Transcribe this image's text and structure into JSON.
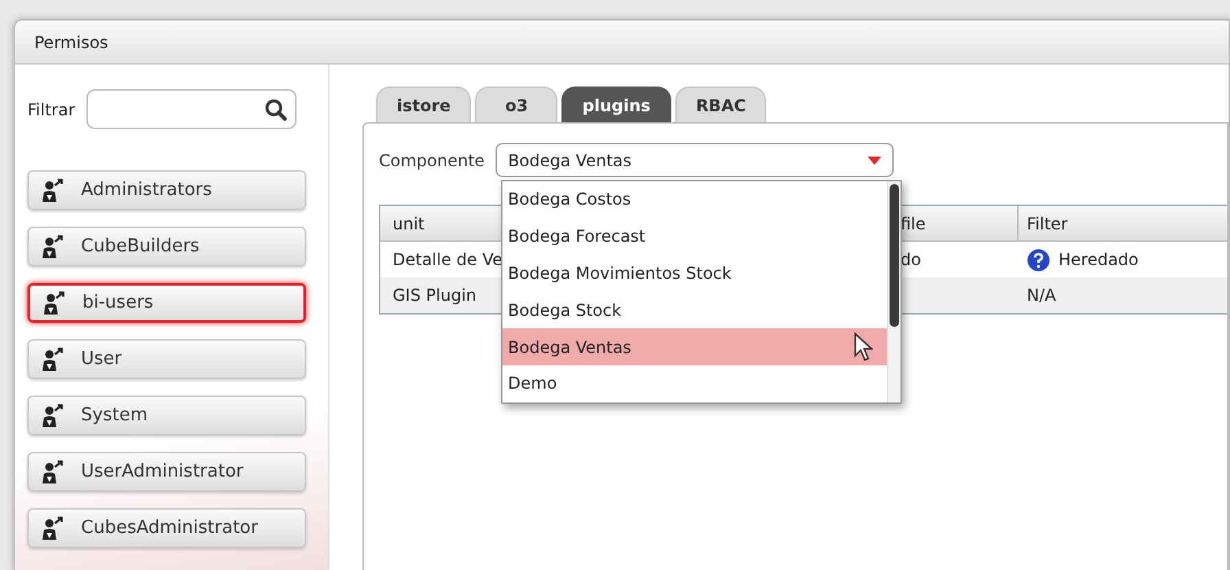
{
  "window": {
    "title": "Permisos"
  },
  "filter": {
    "label": "Filtrar"
  },
  "groups": [
    {
      "label": "Administrators",
      "selected": false
    },
    {
      "label": "CubeBuilders",
      "selected": false
    },
    {
      "label": "bi-users",
      "selected": true
    },
    {
      "label": "User",
      "selected": false
    },
    {
      "label": "System",
      "selected": false
    },
    {
      "label": "UserAdministrator",
      "selected": false
    },
    {
      "label": "CubesAdministrator",
      "selected": false
    }
  ],
  "tabs": [
    {
      "label": "istore",
      "selected": false
    },
    {
      "label": "o3",
      "selected": false
    },
    {
      "label": "plugins",
      "selected": true
    },
    {
      "label": "RBAC",
      "selected": false
    }
  ],
  "component": {
    "label": "Componente",
    "value": "Bodega Ventas",
    "expanded": true,
    "options": [
      {
        "label": "Bodega Costos",
        "selected": false
      },
      {
        "label": "Bodega Forecast",
        "selected": false
      },
      {
        "label": "Bodega Movimientos Stock",
        "selected": false
      },
      {
        "label": "Bodega Stock",
        "selected": false
      },
      {
        "label": "Bodega Ventas",
        "selected": true
      },
      {
        "label": "Demo",
        "selected": false
      }
    ]
  },
  "table": {
    "columns": [
      "unit",
      "file",
      "Filter"
    ],
    "rows": [
      {
        "cells": [
          {
            "text": "Detalle de Ve",
            "kind": "text"
          },
          {
            "text": "do",
            "kind": "text"
          },
          {
            "text": "Heredado",
            "kind": "help"
          }
        ]
      },
      {
        "cells": [
          {
            "text": "GIS Plugin",
            "kind": "text"
          },
          {
            "text": "",
            "kind": "text"
          },
          {
            "text": "N/A",
            "kind": "text"
          }
        ]
      }
    ]
  }
}
